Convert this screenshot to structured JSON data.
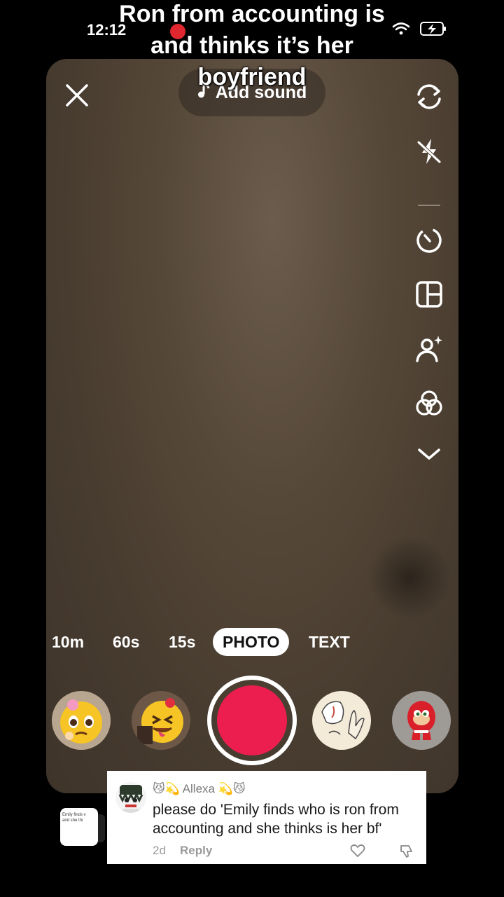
{
  "status_bar": {
    "time": "12:12"
  },
  "caption": {
    "line1": "Ron from accounting is",
    "line2": "and thinks it’s her",
    "line3": "boyfriend"
  },
  "camera": {
    "close_icon": "close-icon",
    "add_sound_label": "Add sound",
    "tools": [
      "flip-camera-icon",
      "flash-off-icon",
      "timer-icon",
      "layout-icon",
      "beauty-icon",
      "filters-icon",
      "chevron-down-icon"
    ],
    "modes": [
      "10m",
      "60s",
      "15s",
      "PHOTO",
      "TEXT"
    ],
    "active_mode": "PHOTO",
    "record_color": "#ec1e4f"
  },
  "effects": [
    "pleading-emoji-effect",
    "tongue-emoji-effect",
    "cartoon-hand-effect",
    "knuckles-effect"
  ],
  "comment": {
    "username": "😼💫 Allexa 💫😼",
    "text": "please do 'Emily finds who is ron from accounting and she thinks is her bf'",
    "date": "2d",
    "reply_label": "Reply"
  },
  "sticker": {
    "line1": "Emily finds v",
    "line2": "and she thi"
  }
}
